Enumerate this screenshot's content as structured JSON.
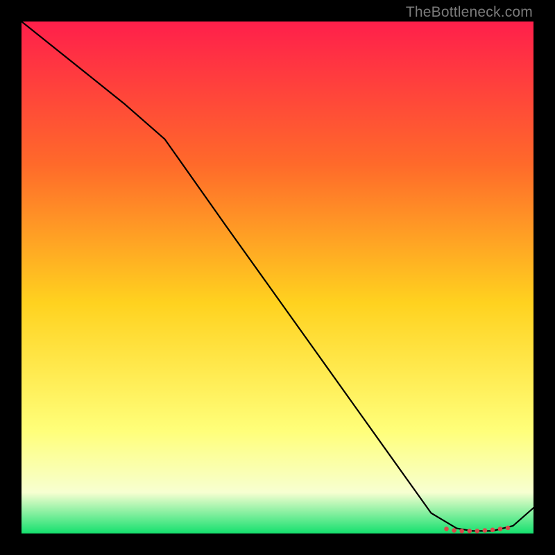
{
  "watermark": "TheBottleneck.com",
  "colors": {
    "gradient_top": "#ff1f4b",
    "gradient_mid1": "#ff6a2a",
    "gradient_mid2": "#ffd21f",
    "gradient_low": "#ffff7a",
    "gradient_pale": "#f7ffd1",
    "gradient_bottom": "#14e06e",
    "line": "#000000",
    "marker": "#d84b4b"
  },
  "chart_data": {
    "type": "line",
    "title": "",
    "xlabel": "",
    "ylabel": "",
    "xlim": [
      0,
      100
    ],
    "ylim": [
      0,
      100
    ],
    "series": [
      {
        "name": "curve",
        "x": [
          0,
          10,
          20,
          28,
          40,
          50,
          60,
          70,
          80,
          85,
          88,
          92,
          96,
          100
        ],
        "y": [
          100,
          92,
          84,
          77,
          60,
          46,
          32,
          18,
          4,
          1,
          0.5,
          0.5,
          1.5,
          5
        ]
      }
    ],
    "markers": {
      "name": "valley-cluster",
      "x": [
        83,
        84.5,
        86,
        87.5,
        89,
        90.5,
        92,
        93.5,
        95
      ],
      "y": [
        0.9,
        0.6,
        0.5,
        0.5,
        0.5,
        0.6,
        0.7,
        0.9,
        1.1
      ]
    }
  }
}
